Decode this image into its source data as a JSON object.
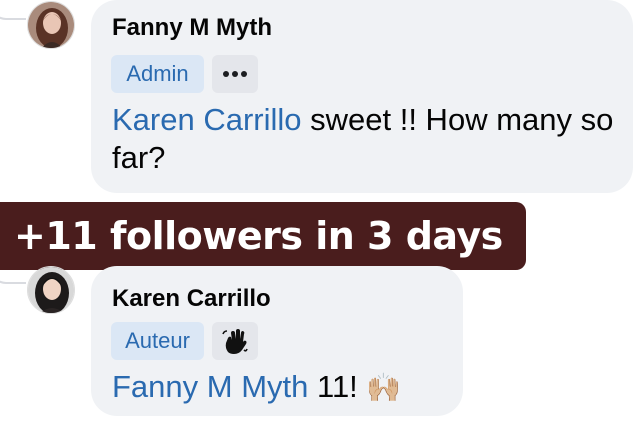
{
  "comments": [
    {
      "author": "Fanny M Myth",
      "role": "Admin",
      "chip_icon": "more-options-icon",
      "mention": "Karen Carrillo",
      "text": " sweet !! How many so far?"
    },
    {
      "author": "Karen Carrillo",
      "role": "Auteur",
      "chip_icon": "waving-hand-icon",
      "mention": "Fanny M Myth",
      "text": " 11! ",
      "emoji": "🙌🏼",
      "emoji_icon": "raising-hands-icon"
    }
  ],
  "overlay": {
    "caption": "+11 followers in 3 days"
  },
  "colors": {
    "bubble": "#f0f2f5",
    "badge_bg": "#dbe7f5",
    "badge_text": "#2a6ab0",
    "mention": "#2a6ab0",
    "caption_bg": "#4a1d1d",
    "caption_text": "#ffffff"
  }
}
